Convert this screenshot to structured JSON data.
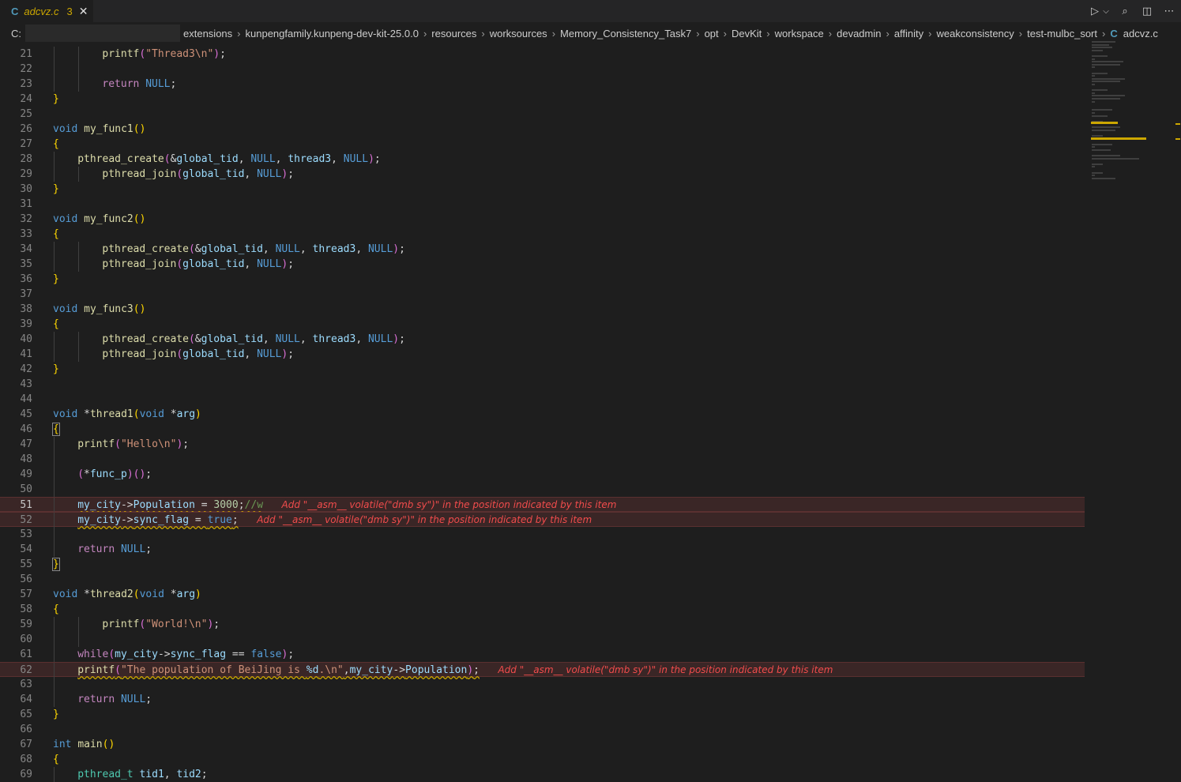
{
  "tab": {
    "icon": "C",
    "filename": "adcvz.c",
    "problem_count": "3",
    "close": "✕"
  },
  "tab_actions": {
    "run_icon": "run-debug-icon",
    "run_glyph": "▷",
    "dropdown_glyph": "⌵",
    "search_glyph": "⌕",
    "split_glyph": "◫",
    "more_glyph": "⋯"
  },
  "breadcrumb": {
    "drive": "C:",
    "segments": [
      "extensions",
      "kunpengfamily.kunpeng-dev-kit-25.0.0",
      "resources",
      "worksources",
      "Memory_Consistency_Task7",
      "opt",
      "DevKit",
      "workspace",
      "devadmin",
      "affinity",
      "weakconsistency",
      "test-mulbc_sort"
    ],
    "file_icon": "C",
    "file": "adcvz.c",
    "separator": "›"
  },
  "editor": {
    "hint_text": "Add \"__asm__ volatile(\"dmb sy\")\" in the position indicated by this item",
    "lines": [
      {
        "n": "21",
        "indent": 2,
        "html": "<span class='fn'>printf</span><span class='brk2'>(</span><span class='str'>\"Thread3\\n\"</span><span class='brk2'>)</span>;"
      },
      {
        "n": "22",
        "indent": 2,
        "html": ""
      },
      {
        "n": "23",
        "indent": 2,
        "html": "<span class='ctl'>return</span> <span class='kw'>NULL</span>;"
      },
      {
        "n": "24",
        "indent": 0,
        "html": "<span class='brk'>}</span>"
      },
      {
        "n": "25",
        "indent": 0,
        "html": ""
      },
      {
        "n": "26",
        "indent": 0,
        "html": "<span class='kw'>void</span> <span class='fn'>my_func1</span><span class='brk'>()</span>"
      },
      {
        "n": "27",
        "indent": 0,
        "html": "<span class='brk'>{</span>"
      },
      {
        "n": "28",
        "indent": 1,
        "html": "<span class='fn'>pthread_create</span><span class='brk2'>(</span>&amp;<span class='var'>global_tid</span>, <span class='kw'>NULL</span>, <span class='var'>thread3</span>, <span class='kw'>NULL</span><span class='brk2'>)</span>;"
      },
      {
        "n": "29",
        "indent": 2,
        "html": "<span class='fn'>pthread_join</span><span class='brk2'>(</span><span class='var'>global_tid</span>, <span class='kw'>NULL</span><span class='brk2'>)</span>;"
      },
      {
        "n": "30",
        "indent": 0,
        "html": "<span class='brk'>}</span>"
      },
      {
        "n": "31",
        "indent": 0,
        "html": ""
      },
      {
        "n": "32",
        "indent": 0,
        "html": "<span class='kw'>void</span> <span class='fn'>my_func2</span><span class='brk'>()</span>"
      },
      {
        "n": "33",
        "indent": 0,
        "html": "<span class='brk'>{</span>"
      },
      {
        "n": "34",
        "indent": 2,
        "html": "<span class='fn'>pthread_create</span><span class='brk2'>(</span>&amp;<span class='var'>global_tid</span>, <span class='kw'>NULL</span>, <span class='var'>thread3</span>, <span class='kw'>NULL</span><span class='brk2'>)</span>;"
      },
      {
        "n": "35",
        "indent": 2,
        "html": "<span class='fn'>pthread_join</span><span class='brk2'>(</span><span class='var'>global_tid</span>, <span class='kw'>NULL</span><span class='brk2'>)</span>;"
      },
      {
        "n": "36",
        "indent": 0,
        "html": "<span class='brk'>}</span>"
      },
      {
        "n": "37",
        "indent": 0,
        "html": ""
      },
      {
        "n": "38",
        "indent": 0,
        "html": "<span class='kw'>void</span> <span class='fn'>my_func3</span><span class='brk'>()</span>"
      },
      {
        "n": "39",
        "indent": 0,
        "html": "<span class='brk'>{</span>"
      },
      {
        "n": "40",
        "indent": 2,
        "html": "<span class='fn'>pthread_create</span><span class='brk2'>(</span>&amp;<span class='var'>global_tid</span>, <span class='kw'>NULL</span>, <span class='var'>thread3</span>, <span class='kw'>NULL</span><span class='brk2'>)</span>;"
      },
      {
        "n": "41",
        "indent": 2,
        "html": "<span class='fn'>pthread_join</span><span class='brk2'>(</span><span class='var'>global_tid</span>, <span class='kw'>NULL</span><span class='brk2'>)</span>;"
      },
      {
        "n": "42",
        "indent": 0,
        "html": "<span class='brk'>}</span>"
      },
      {
        "n": "43",
        "indent": 0,
        "html": ""
      },
      {
        "n": "44",
        "indent": 0,
        "html": ""
      },
      {
        "n": "45",
        "indent": 0,
        "html": "<span class='kw'>void</span> *<span class='fn'>thread1</span><span class='brk'>(</span><span class='kw'>void</span> *<span class='var'>arg</span><span class='brk'>)</span>"
      },
      {
        "n": "46",
        "indent": 0,
        "html": "<span class='brk brbox'>{</span>"
      },
      {
        "n": "47",
        "indent": 1,
        "html": "<span class='fn'>printf</span><span class='brk2'>(</span><span class='str'>\"Hello\\n\"</span><span class='brk2'>)</span>;"
      },
      {
        "n": "48",
        "indent": 1,
        "html": ""
      },
      {
        "n": "49",
        "indent": 1,
        "html": "<span class='brk2'>(</span>*<span class='var'>func_p</span><span class='brk2'>)()</span>;"
      },
      {
        "n": "50",
        "indent": 1,
        "html": ""
      },
      {
        "n": "51",
        "indent": 1,
        "hl": true,
        "cur": true,
        "html": "<span class='warn'><span class='var'>my_city</span>-&gt;<span class='var'>Population</span> = <span class='num'>3000</span>;<span class='cmt'>//w</span></span>   <span class='hint'>Add \"__asm__ volatile(\"dmb sy\")\" in the position indicated by this item</span>"
      },
      {
        "n": "52",
        "indent": 1,
        "hl": true,
        "html": "<span class='warn'><span class='var'>my_city</span>-&gt;<span class='var'>sync_flag</span> = <span class='kw'>true</span>;</span>   <span class='hint'>Add \"__asm__ volatile(\"dmb sy\")\" in the position indicated by this item</span>"
      },
      {
        "n": "53",
        "indent": 1,
        "html": ""
      },
      {
        "n": "54",
        "indent": 1,
        "html": "<span class='ctl'>return</span> <span class='kw'>NULL</span>;"
      },
      {
        "n": "55",
        "indent": 0,
        "html": "<span class='brk brbox'>}</span>"
      },
      {
        "n": "56",
        "indent": 0,
        "html": ""
      },
      {
        "n": "57",
        "indent": 0,
        "html": "<span class='kw'>void</span> *<span class='fn'>thread2</span><span class='brk'>(</span><span class='kw'>void</span> *<span class='var'>arg</span><span class='brk'>)</span>"
      },
      {
        "n": "58",
        "indent": 0,
        "html": "<span class='brk'>{</span>"
      },
      {
        "n": "59",
        "indent": 2,
        "html": "<span class='fn'>printf</span><span class='brk2'>(</span><span class='str'>\"World!\\n\"</span><span class='brk2'>)</span>;"
      },
      {
        "n": "60",
        "indent": 2,
        "html": ""
      },
      {
        "n": "61",
        "indent": 1,
        "html": "<span class='ctl'>while</span><span class='brk2'>(</span><span class='var'>my_city</span>-&gt;<span class='var'>sync_flag</span> == <span class='kw'>false</span><span class='brk2'>)</span>;"
      },
      {
        "n": "62",
        "indent": 1,
        "hl": true,
        "html": "<span class='warn'><span class='fn'>printf</span><span class='brk2'>(</span><span class='str'>\"The population of BeiJing is </span><span class='fmt'>%d</span><span class='str'>.\\n\"</span>,<span class='var'>my_city</span>-&gt;<span class='var'>Population</span><span class='brk2'>)</span>;</span>   <span class='hint'>Add \"__asm__ volatile(\"dmb sy\")\" in the position indicated by this item</span>"
      },
      {
        "n": "63",
        "indent": 1,
        "html": ""
      },
      {
        "n": "64",
        "indent": 1,
        "html": "<span class='ctl'>return</span> <span class='kw'>NULL</span>;"
      },
      {
        "n": "65",
        "indent": 0,
        "html": "<span class='brk'>}</span>"
      },
      {
        "n": "66",
        "indent": 0,
        "html": ""
      },
      {
        "n": "67",
        "indent": 0,
        "html": "<span class='kw'>int</span> <span class='fn'>main</span><span class='brk'>()</span>"
      },
      {
        "n": "68",
        "indent": 0,
        "html": "<span class='brk'>{</span>"
      },
      {
        "n": "69",
        "indent": 1,
        "html": "<span class='type'>pthread_t</span> <span class='var'>tid1</span>, <span class='var'>tid2</span>;"
      }
    ]
  },
  "colors": {
    "background": "#1e1e1e",
    "warning": "#cca700",
    "hint": "#f14c4c"
  }
}
